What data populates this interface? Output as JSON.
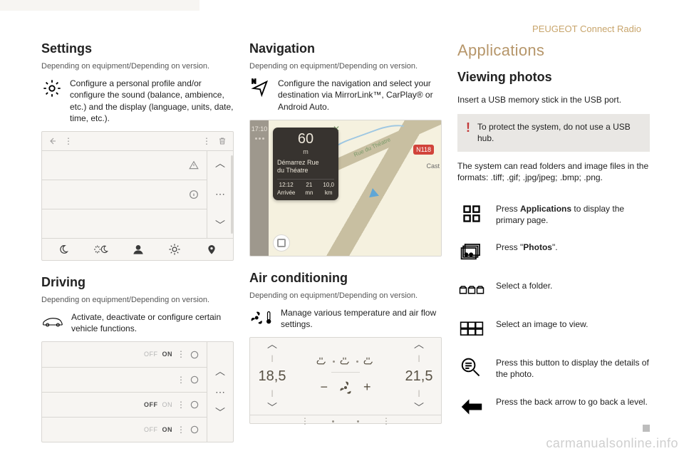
{
  "breadcrumb": "PEUGEOT Connect Radio",
  "col1": {
    "settings_h": "Settings",
    "settings_dep": "Depending on equipment/Depending on version.",
    "settings_txt": "Configure a personal profile and/or configure the sound (balance, ambience, etc.) and the display (language, units, date, time, etc.).",
    "driving_h": "Driving",
    "driving_dep": "Depending on equipment/Depending on version.",
    "driving_txt": "Activate, deactivate or configure certain vehicle functions.",
    "offon_off": "OFF",
    "offon_on": "ON",
    "dots": "⋯"
  },
  "col2": {
    "nav_h": "Navigation",
    "nav_dep": "Depending on equipment/Depending on version.",
    "nav_txt": "Configure the navigation and select your destination via MirrorLink™, CarPlay® or Android Auto.",
    "nav_clock": "17:10",
    "nav_card": {
      "dist": "60",
      "unit": "m",
      "line1": "Démarrez Rue",
      "line2": "du Théatre",
      "eta_t": "12:12",
      "eta_l": "Arrivée",
      "dur_t": "21",
      "dur_l": "mn",
      "rem_t": "10,0",
      "rem_l": "km"
    },
    "nav_roadname": "Rue du Théatre",
    "nav_badge": "N118",
    "nav_cast": "Cast",
    "ac_h": "Air conditioning",
    "ac_dep": "Depending on equipment/Depending on version.",
    "ac_txt": "Manage various temperature and air flow settings.",
    "ac_left": "18,5",
    "ac_right": "21,5",
    "ac_minus": "−",
    "ac_plus": "+"
  },
  "col3": {
    "apps_h": "Applications",
    "view_h": "Viewing photos",
    "insert": "Insert a USB memory stick in the USB port.",
    "warn": "To protect the system, do not use a USB hub.",
    "formats": "The system can read folders and image files in the formats: .tiff; .gif; .jpg/jpeg; .bmp; .png.",
    "s1a": "Press ",
    "s1b": "Applications",
    "s1c": " to display the primary page.",
    "s2a": "Press \"",
    "s2b": "Photos",
    "s2c": "\".",
    "s3": "Select a folder.",
    "s4": "Select an image to view.",
    "s5": "Press this button to display the details of the photo.",
    "s6": "Press the back arrow to go back a level."
  },
  "watermark": "carmanualsonline.info"
}
